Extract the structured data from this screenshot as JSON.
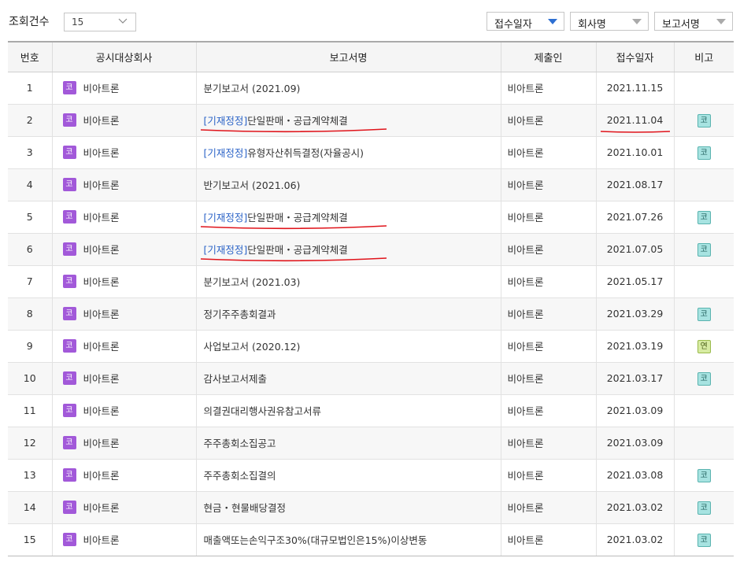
{
  "toolbar": {
    "count_label": "조회건수",
    "count_value": "15",
    "sort_options": [
      "접수일자",
      "회사명",
      "보고서명"
    ]
  },
  "columns": [
    "번호",
    "공시대상회사",
    "보고서명",
    "제출인",
    "접수일자",
    "비고"
  ],
  "rows": [
    {
      "no": "1",
      "market": "코",
      "company": "비아트론",
      "prefix": "",
      "report": "분기보고서 (2021.09)",
      "submitter": "비아트론",
      "date": "2021.11.15",
      "remark": ""
    },
    {
      "no": "2",
      "market": "코",
      "company": "비아트론",
      "prefix": "[기재정정]",
      "report": "단일판매・공급계약체결",
      "submitter": "비아트론",
      "date": "2021.11.04",
      "remark": "코"
    },
    {
      "no": "3",
      "market": "코",
      "company": "비아트론",
      "prefix": "[기재정정]",
      "report": "유형자산취득결정(자율공시)",
      "submitter": "비아트론",
      "date": "2021.10.01",
      "remark": "코"
    },
    {
      "no": "4",
      "market": "코",
      "company": "비아트론",
      "prefix": "",
      "report": "반기보고서 (2021.06)",
      "submitter": "비아트론",
      "date": "2021.08.17",
      "remark": ""
    },
    {
      "no": "5",
      "market": "코",
      "company": "비아트론",
      "prefix": "[기재정정]",
      "report": "단일판매・공급계약체결",
      "submitter": "비아트론",
      "date": "2021.07.26",
      "remark": "코"
    },
    {
      "no": "6",
      "market": "코",
      "company": "비아트론",
      "prefix": "[기재정정]",
      "report": "단일판매・공급계약체결",
      "submitter": "비아트론",
      "date": "2021.07.05",
      "remark": "코"
    },
    {
      "no": "7",
      "market": "코",
      "company": "비아트론",
      "prefix": "",
      "report": "분기보고서 (2021.03)",
      "submitter": "비아트론",
      "date": "2021.05.17",
      "remark": ""
    },
    {
      "no": "8",
      "market": "코",
      "company": "비아트론",
      "prefix": "",
      "report": "정기주주총회결과",
      "submitter": "비아트론",
      "date": "2021.03.29",
      "remark": "코"
    },
    {
      "no": "9",
      "market": "코",
      "company": "비아트론",
      "prefix": "",
      "report": "사업보고서 (2020.12)",
      "submitter": "비아트론",
      "date": "2021.03.19",
      "remark": "연"
    },
    {
      "no": "10",
      "market": "코",
      "company": "비아트론",
      "prefix": "",
      "report": "감사보고서제출",
      "submitter": "비아트론",
      "date": "2021.03.17",
      "remark": "코"
    },
    {
      "no": "11",
      "market": "코",
      "company": "비아트론",
      "prefix": "",
      "report": "의결권대리행사권유참고서류",
      "submitter": "비아트론",
      "date": "2021.03.09",
      "remark": ""
    },
    {
      "no": "12",
      "market": "코",
      "company": "비아트론",
      "prefix": "",
      "report": "주주총회소집공고",
      "submitter": "비아트론",
      "date": "2021.03.09",
      "remark": ""
    },
    {
      "no": "13",
      "market": "코",
      "company": "비아트론",
      "prefix": "",
      "report": "주주총회소집결의",
      "submitter": "비아트론",
      "date": "2021.03.08",
      "remark": "코"
    },
    {
      "no": "14",
      "market": "코",
      "company": "비아트론",
      "prefix": "",
      "report": "현금・현물배당결정",
      "submitter": "비아트론",
      "date": "2021.03.02",
      "remark": "코"
    },
    {
      "no": "15",
      "market": "코",
      "company": "비아트론",
      "prefix": "",
      "report": "매출액또는손익구조30%(대규모법인은15%)이상변동",
      "submitter": "비아트론",
      "date": "2021.03.02",
      "remark": "코"
    }
  ],
  "highlighted_rows": [
    2,
    5,
    6
  ],
  "highlighted_dates": [
    2
  ],
  "colors": {
    "annotation": "#e0141b",
    "correction_link": "#2b63c7",
    "market_badge": "#a259d9",
    "sort_active": "#2d6fd2"
  }
}
